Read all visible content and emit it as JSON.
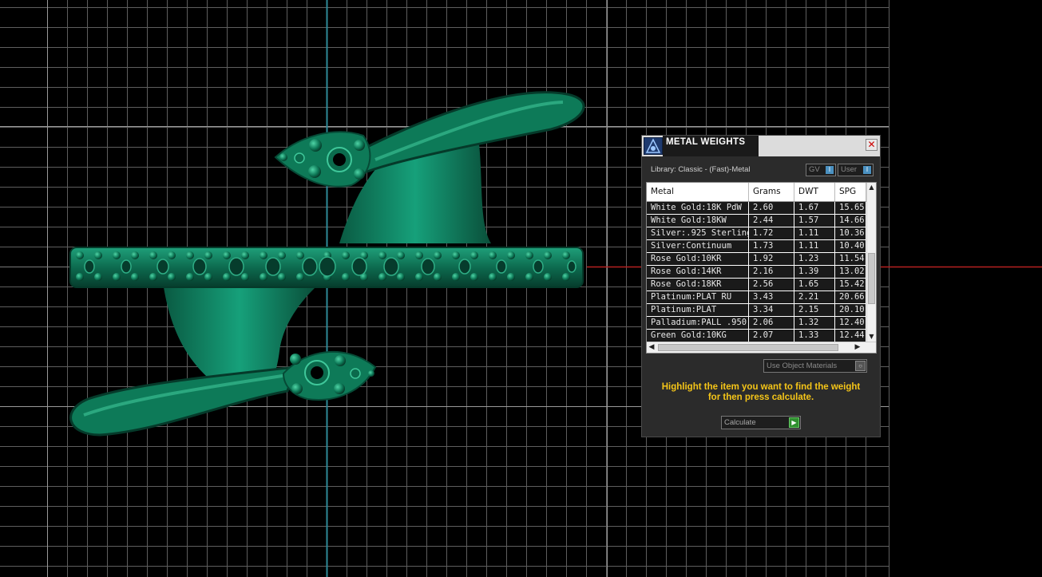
{
  "panel": {
    "title": "METAL WEIGHTS",
    "library_label": "Library: Classic - (Fast)-Metal",
    "gv_toggle": "GV",
    "user_toggle": "User",
    "columns": [
      "Metal",
      "Grams",
      "DWT",
      "SPG"
    ],
    "rows": [
      {
        "metal": "White Gold:18K PdW",
        "grams": "2.60",
        "dwt": "1.67",
        "spg": "15.65"
      },
      {
        "metal": "White Gold:18KW",
        "grams": "2.44",
        "dwt": "1.57",
        "spg": "14.66"
      },
      {
        "metal": "Silver:.925 Sterling",
        "grams": "1.72",
        "dwt": "1.11",
        "spg": "10.36"
      },
      {
        "metal": "Silver:Continuum",
        "grams": "1.73",
        "dwt": "1.11",
        "spg": "10.40"
      },
      {
        "metal": "Rose Gold:10KR",
        "grams": "1.92",
        "dwt": "1.23",
        "spg": "11.54"
      },
      {
        "metal": "Rose Gold:14KR",
        "grams": "2.16",
        "dwt": "1.39",
        "spg": "13.02"
      },
      {
        "metal": "Rose Gold:18KR",
        "grams": "2.56",
        "dwt": "1.65",
        "spg": "15.42"
      },
      {
        "metal": "Platinum:PLAT RU",
        "grams": "3.43",
        "dwt": "2.21",
        "spg": "20.66"
      },
      {
        "metal": "Platinum:PLAT",
        "grams": "3.34",
        "dwt": "2.15",
        "spg": "20.10"
      },
      {
        "metal": "Palladium:PALL .950",
        "grams": "2.06",
        "dwt": "1.32",
        "spg": "12.40"
      },
      {
        "metal": "Green Gold:10KG",
        "grams": "2.07",
        "dwt": "1.33",
        "spg": "12.44"
      }
    ],
    "use_object_materials": "Use Object Materials",
    "hint_line1": "Highlight the item you want to find the weight",
    "hint_line2": "for then press calculate.",
    "calculate_label": "Calculate"
  },
  "colors": {
    "viewport_bg": "#000000",
    "grid": "#7a7a7a",
    "axis_vertical": "#2e7f8c",
    "axis_horizontal": "#b52020",
    "model": "#0f7a5a",
    "hint": "#f5c518"
  },
  "icons": {
    "app_logo": "app-logo-icon",
    "close": "close-icon",
    "scroll_up": "chevron-up-icon",
    "scroll_down": "chevron-down-icon",
    "scroll_left": "chevron-left-icon",
    "scroll_right": "chevron-right-icon",
    "calculate": "play-icon"
  }
}
